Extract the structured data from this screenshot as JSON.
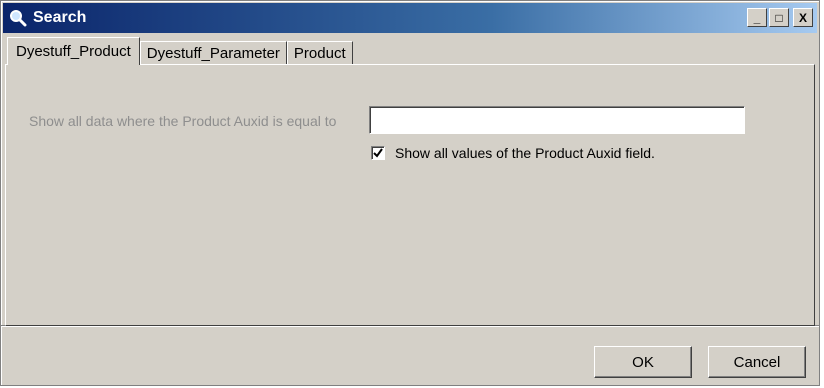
{
  "window": {
    "title": "Search",
    "minimize_label": "_",
    "maximize_label": "□",
    "close_label": "X"
  },
  "tabs": [
    {
      "label": "Dyestuff_Product",
      "active": true
    },
    {
      "label": "Dyestuff_Parameter",
      "active": false
    },
    {
      "label": "Product",
      "active": false
    }
  ],
  "form": {
    "field_label": "Show all data where the  Product Auxid  is equal to",
    "field_value": "",
    "show_all_checked": true,
    "show_all_label": "Show all values of the Product Auxid field."
  },
  "buttons": {
    "ok": "OK",
    "cancel": "Cancel"
  },
  "colors": {
    "titlebar_start": "#0a246a",
    "titlebar_end": "#a6caf0",
    "face": "#d4d0c8",
    "disabled_text": "#8e8e8e"
  }
}
